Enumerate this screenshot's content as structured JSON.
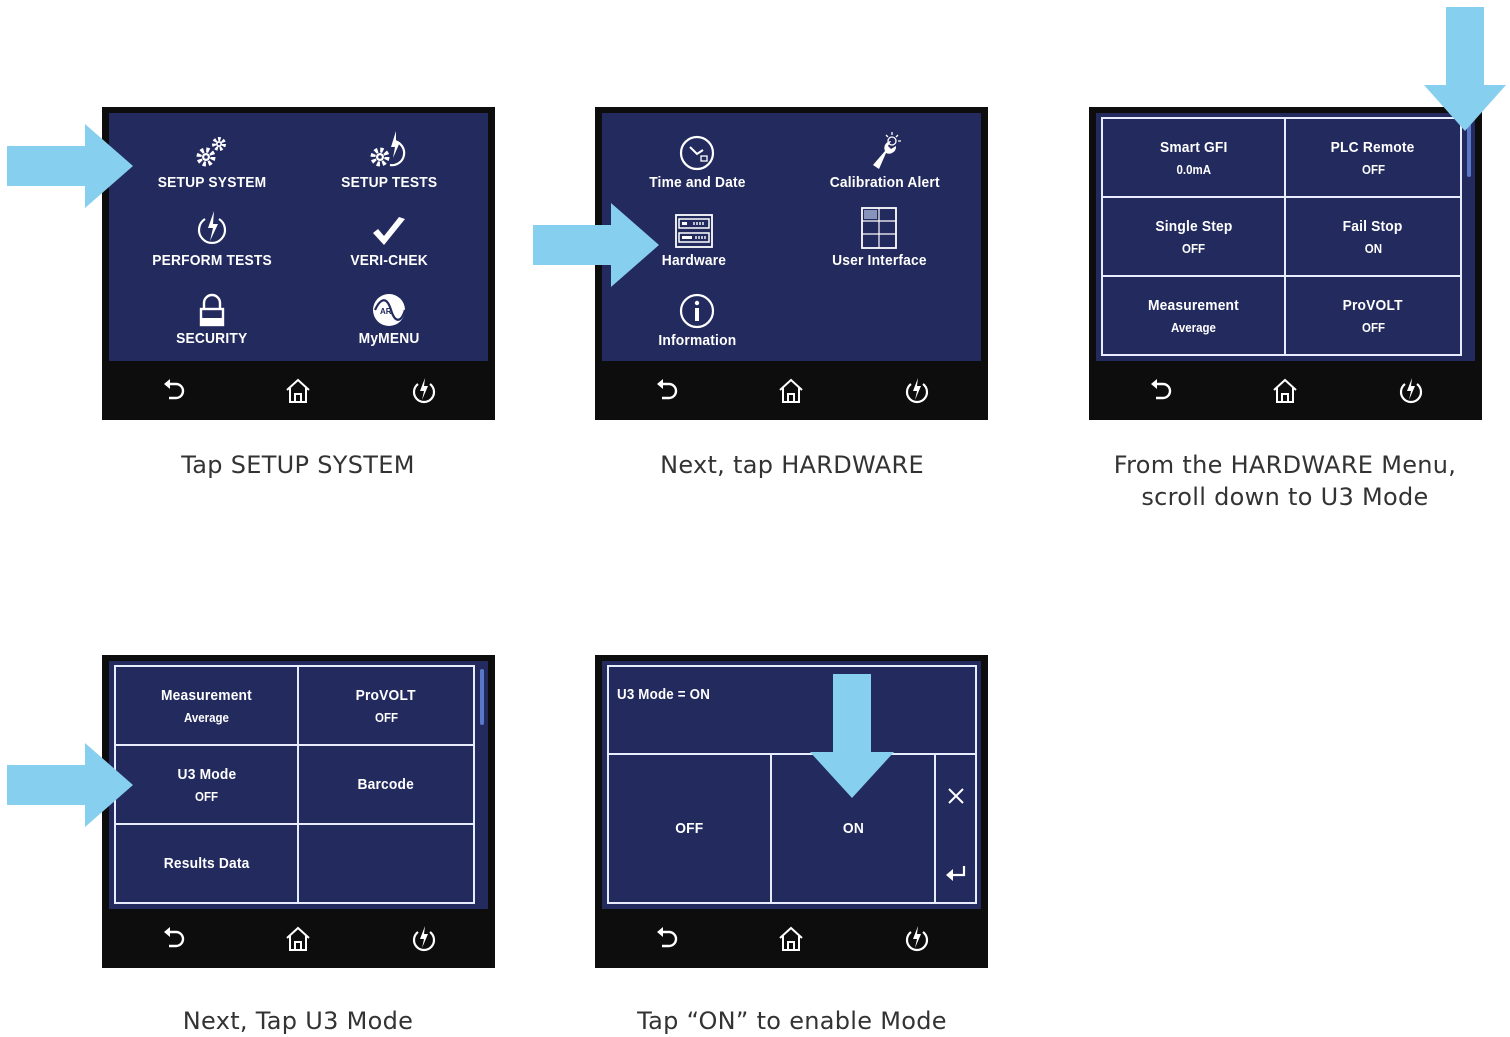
{
  "colors": {
    "screen_bg": "#222a5e",
    "bezel": "#0d0d0d",
    "arrow": "#87cfef",
    "text": "#ffffff"
  },
  "nav": {
    "back_icon": "undo-arrow-icon",
    "home_icon": "home-icon",
    "power_icon": "power-icon"
  },
  "panel1": {
    "setup_system": "SETUP SYSTEM",
    "setup_tests": "SETUP TESTS",
    "perform_tests": "PERFORM TESTS",
    "veri_chek": "VERI-CHEK",
    "security": "SECURITY",
    "mymenu": "MyMENU",
    "mymenu_logo_text": "AR",
    "caption": "Tap SETUP SYSTEM"
  },
  "panel2": {
    "time_and_date": "Time and Date",
    "calibration_alert": "Calibration Alert",
    "hardware": "Hardware",
    "user_interface": "User Interface",
    "information": "Information",
    "caption": "Next, tap HARDWARE"
  },
  "panel3": {
    "cells": [
      {
        "label": "Smart GFI",
        "value": "0.0mA"
      },
      {
        "label": "PLC Remote",
        "value": "OFF"
      },
      {
        "label": "Single Step",
        "value": "OFF"
      },
      {
        "label": "Fail Stop",
        "value": "ON"
      },
      {
        "label": "Measurement",
        "value": "Average"
      },
      {
        "label": "ProVOLT",
        "value": "OFF"
      }
    ],
    "caption_line1": "From the HARDWARE Menu,",
    "caption_line2": "scroll down to U3 Mode"
  },
  "panel4": {
    "cells": [
      {
        "label": "Measurement",
        "value": "Average"
      },
      {
        "label": "ProVOLT",
        "value": "OFF"
      },
      {
        "label": "U3 Mode",
        "value": "OFF"
      },
      {
        "label": "Barcode",
        "value": ""
      },
      {
        "label": "Results Data",
        "value": ""
      },
      {
        "label": "",
        "value": ""
      }
    ],
    "caption": "Next, Tap U3 Mode"
  },
  "panel5": {
    "status": "U3 Mode = ON",
    "off": "OFF",
    "on": "ON",
    "close_icon": "close-icon",
    "enter_icon": "enter-icon",
    "caption": "Tap “ON” to enable Mode"
  }
}
